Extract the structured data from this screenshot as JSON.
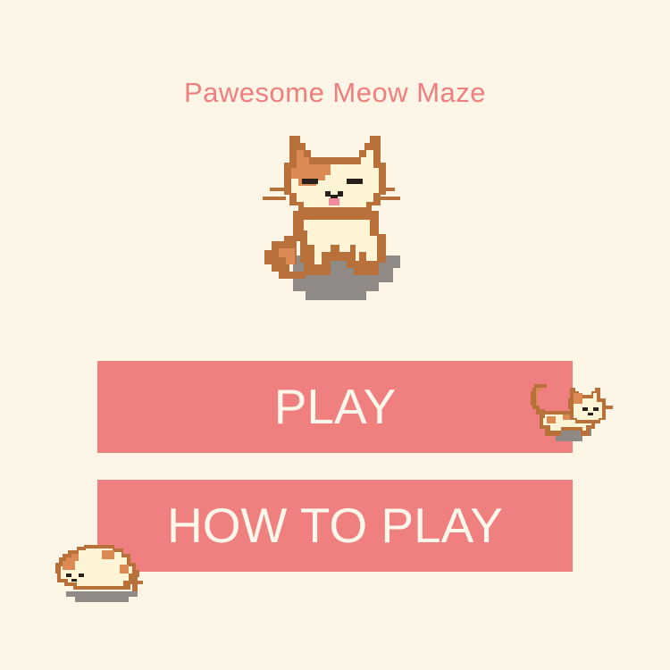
{
  "game": {
    "title": "Pawesome Meow Maze"
  },
  "menu": {
    "play_label": "PLAY",
    "how_to_play_label": "HOW TO PLAY"
  },
  "colors": {
    "background": "#fdf6e6",
    "accent": "#f08080",
    "button_text": "#fff7ea",
    "cat_outline": "#b9713c",
    "cat_patch": "#dc8a54",
    "cat_body": "#fff4d6",
    "shadow": "#8f8a86"
  },
  "sprites": {
    "mascot": "sitting-cat-icon",
    "runner": "walking-cat-icon",
    "sleeper": "sleeping-cat-icon"
  }
}
